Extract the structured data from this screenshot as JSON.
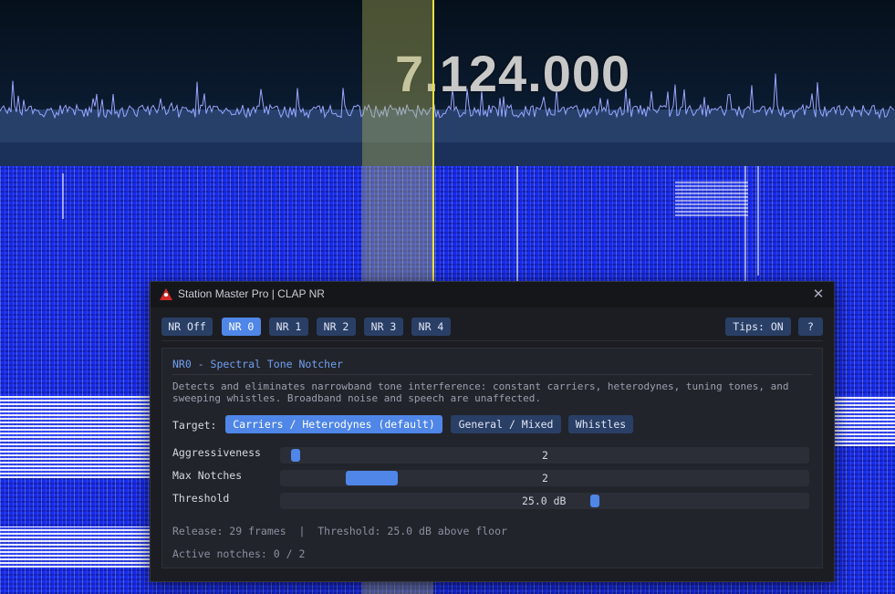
{
  "spectrum": {
    "frequency": "7.124.000"
  },
  "dialog": {
    "title": "Station Master Pro | CLAP NR",
    "nr_buttons": [
      "NR Off",
      "NR 0",
      "NR 1",
      "NR 2",
      "NR 3",
      "NR 4"
    ],
    "active_nr": "NR 0",
    "tips_button": "Tips: ON",
    "help_button": "?",
    "section_title": "NR0 - Spectral Tone Notcher",
    "description": "Detects and eliminates narrowband tone interference: constant carriers, heterodynes, tuning tones, and sweeping whistles. Broadband noise and speech are unaffected.",
    "target_label": "Target:",
    "target_options": [
      "Carriers / Heterodynes (default)",
      "General / Mixed",
      "Whistles"
    ],
    "active_target": "Carriers / Heterodynes (default)",
    "sliders": {
      "aggressiveness": {
        "label": "Aggressiveness",
        "value": "2",
        "fraction": 0.0
      },
      "max_notches": {
        "label": "Max Notches",
        "value": "2",
        "fraction": 0.12
      },
      "threshold": {
        "label": "Threshold",
        "value": "25.0 dB",
        "fraction": 0.6
      }
    },
    "status_line": "Release: 29 frames  |  Threshold: 25.0 dB above floor",
    "active_notches": "Active notches: 0 / 2"
  },
  "colors": {
    "accent": "#4f86e8",
    "button": "#2a3f66",
    "waterfall": "#1a2ee0",
    "tuning_line": "#e8e040",
    "close_icon_color": "#aab"
  },
  "icons": {
    "title": "warning-triangle-icon",
    "close": "close-icon"
  }
}
